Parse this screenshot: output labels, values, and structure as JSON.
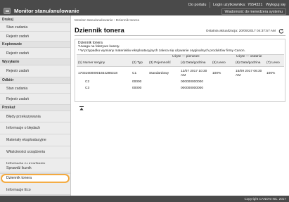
{
  "header": {
    "app_title": "Monitor stanu/anulowanie",
    "portal_link": "Do portalu",
    "login_label": "Login użytkownika:",
    "login_value": "7654321",
    "logout_link": "Wyloguj się",
    "admin_link": "Wiadomość do menedżera systemu"
  },
  "sidebar": {
    "sections": [
      {
        "label": "Drukuj",
        "items": [
          "Stan zadania",
          "Rejestr zadań"
        ]
      },
      {
        "label": "Kopiowanie",
        "items": [
          "Rejestr zadań"
        ]
      },
      {
        "label": "Wysyłanie",
        "items": [
          "Rejestr zadań"
        ]
      },
      {
        "label": "Odbiór",
        "items": [
          "Stan zadania",
          "Rejestr zadań"
        ]
      },
      {
        "label": "Przekaż",
        "items": [
          "Błędy przekazywania",
          "Informacje o błędach",
          "Materiały eksploatacyjne",
          "Właściwości urządzenia",
          "Informacje o urządzeniu",
          "Sprawdź licznik",
          "Dziennik tonera",
          "Informacje Eco"
        ]
      }
    ],
    "active_item": "Dziennik tonera"
  },
  "main": {
    "breadcrumb": "Monitor stanu/anulowanie : Dziennik tonera",
    "title": "Dziennik tonera",
    "last_update_label": "Ostatnia aktualizacja:",
    "last_update_value": "20/09/2017 04:37:57 AM",
    "panel": {
      "title": "Dziennik tonera",
      "notes": [
        "*Uwaga na fałszywe kasety.",
        "* W przypadku wymiany materiałów eksploatacyjnych zaleca się używanie oryginalnych produktów firmy Canon."
      ],
      "header_used_recent": "Użyte — ostatnie",
      "header_used_first": "Użyte — pierwsze",
      "columns": [
        "(1) Numer seryjny",
        "(2) Typ",
        "(3) Pojemność",
        "(4) Data/godzina",
        "(5) Lewo",
        "(6) Data/godzina",
        "(7) Lewo"
      ],
      "rows": [
        {
          "serial": "170316000001654286318",
          "type": "C1",
          "capacity": "Standardowy",
          "date1": "12/07 2017 10:30 AM",
          "left1": "100%",
          "date2": "15/09 2017 06:30 AM",
          "left2": "100%"
        },
        {
          "serial": "C2",
          "type": "",
          "capacity": "00000",
          "date1": "000000000000",
          "left1": "",
          "date2": "",
          "left2": ""
        },
        {
          "serial": "C3",
          "type": "",
          "capacity": "00000",
          "date1": "000000000000",
          "left1": "",
          "date2": "",
          "left2": ""
        }
      ]
    }
  },
  "footer": {
    "copyright": "Copyright CANON INC. 2017"
  },
  "colors": {
    "topbar": "#4a4a4a",
    "sidebar_bg": "#ececec",
    "active_highlight": "#f0a030"
  },
  "icons": {
    "logo": "device-monitor-icon",
    "refresh": "refresh-icon",
    "back": "back-to-top-icon"
  }
}
